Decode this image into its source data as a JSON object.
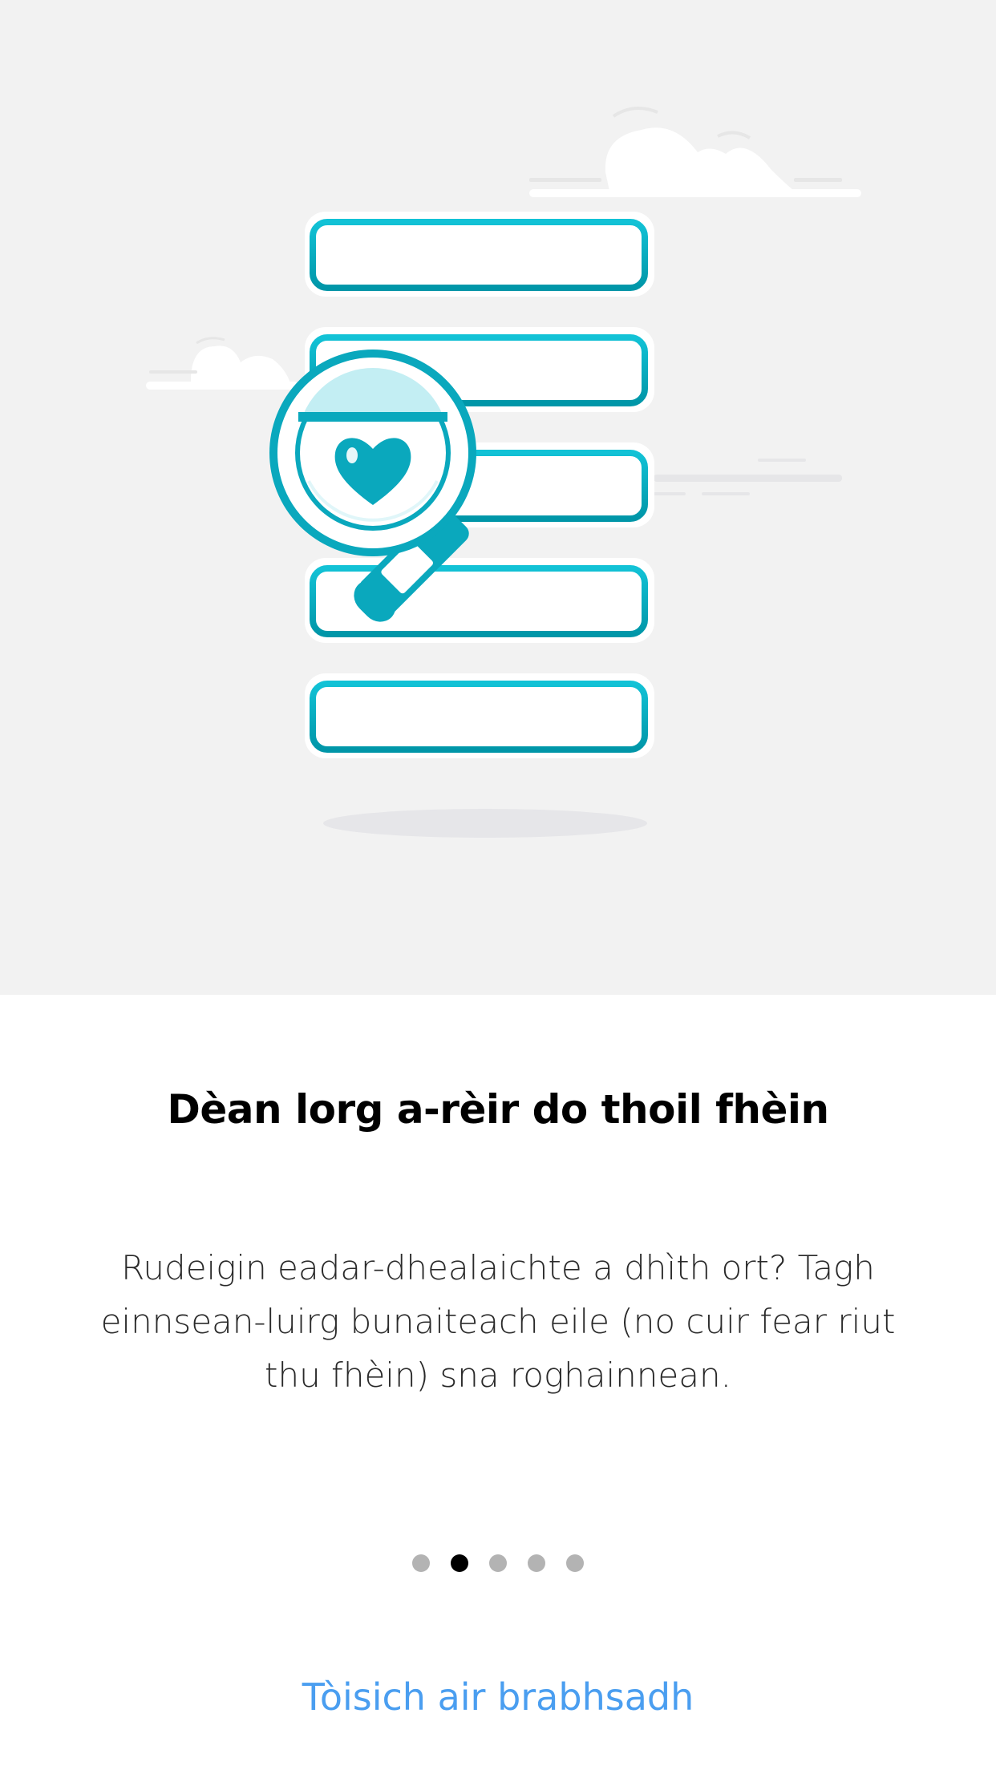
{
  "onboarding": {
    "title": "Dèan lorg a-rèir do thoil fhèin",
    "body": "Rudeigin eadar-dhealaichte a dhìth ort? Tagh einnsean-luirg bunaiteach eile (no cuir fear riut thu fhèin) sna roghainnean.",
    "pager": {
      "total": 5,
      "active_index": 1
    },
    "start_button_label": "Tòisich air brabhsadh"
  },
  "colors": {
    "hero_background": "#f2f2f2",
    "accent_teal": "#00a7bd",
    "link_blue": "#4a9ef0",
    "dot_active": "#000000",
    "dot_inactive": "#b3b3b3"
  },
  "illustration": {
    "icons": [
      "search-results-list",
      "magnifying-glass-icon",
      "heart-icon",
      "cloud-icon"
    ]
  }
}
